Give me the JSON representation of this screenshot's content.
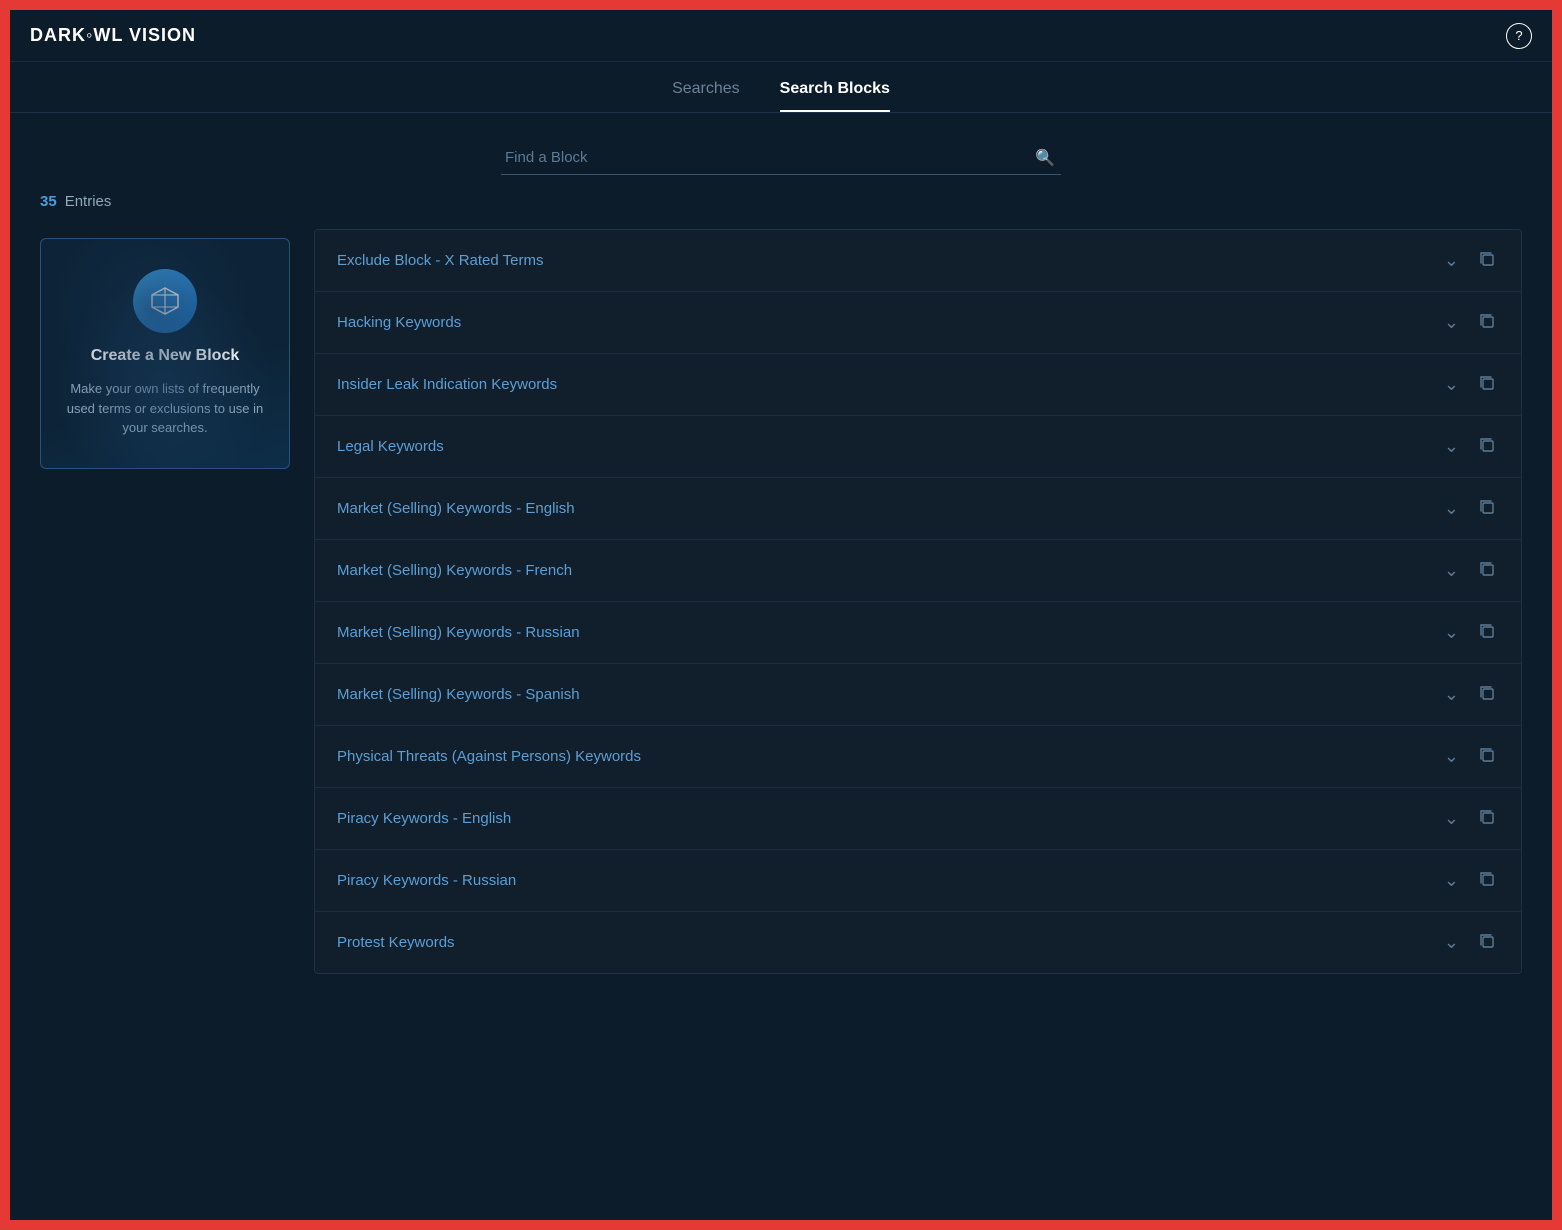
{
  "app": {
    "logo_text": "DARK◦WL VISION",
    "help_icon": "?"
  },
  "tabs": [
    {
      "label": "Searches",
      "active": false
    },
    {
      "label": "Search Blocks",
      "active": true
    }
  ],
  "search": {
    "placeholder": "Find a Block"
  },
  "entries": {
    "count": "35",
    "label": "Entries"
  },
  "create_block": {
    "icon": "⬡",
    "title": "Create a New Block",
    "description": "Make your own lists of frequently used terms or exclusions to use in your searches."
  },
  "blocks": [
    {
      "name": "Exclude Block - X Rated Terms"
    },
    {
      "name": "Hacking Keywords"
    },
    {
      "name": "Insider Leak Indication Keywords"
    },
    {
      "name": "Legal Keywords"
    },
    {
      "name": "Market (Selling) Keywords - English"
    },
    {
      "name": "Market (Selling) Keywords - French"
    },
    {
      "name": "Market (Selling) Keywords - Russian"
    },
    {
      "name": "Market (Selling) Keywords - Spanish"
    },
    {
      "name": "Physical Threats (Against Persons) Keywords"
    },
    {
      "name": "Piracy Keywords - English"
    },
    {
      "name": "Piracy Keywords - Russian"
    },
    {
      "name": "Protest Keywords"
    }
  ],
  "icons": {
    "chevron_down": "⌄",
    "copy": "⧉",
    "search": "🔍"
  }
}
